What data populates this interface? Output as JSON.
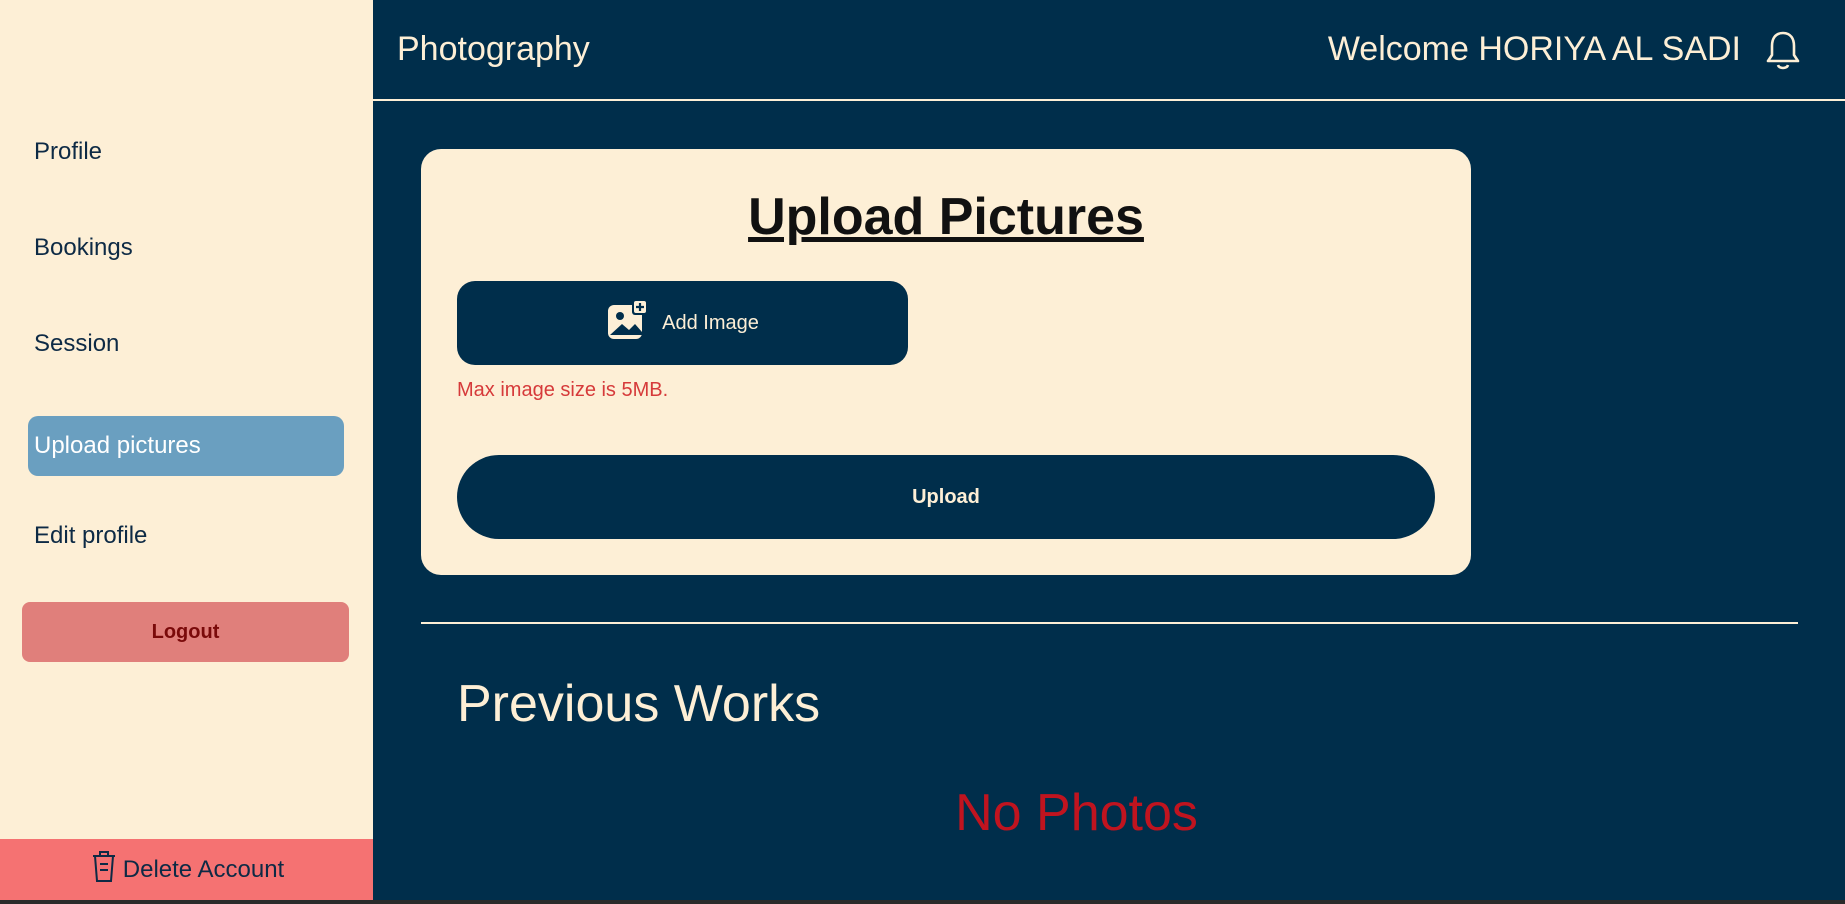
{
  "header": {
    "brand": "Photography",
    "welcome": "Welcome HORIYA AL SADI",
    "bell_icon": "bell-icon"
  },
  "sidebar": {
    "items": [
      {
        "label": "Profile",
        "active": false
      },
      {
        "label": "Bookings",
        "active": false
      },
      {
        "label": "Session",
        "active": false
      },
      {
        "label": "Upload pictures",
        "active": true
      },
      {
        "label": "Edit profile",
        "active": false
      }
    ],
    "logout_label": "Logout",
    "delete_label": "Delete Account",
    "delete_icon": "trash-icon"
  },
  "upload_card": {
    "title": "Upload Pictures",
    "add_image_label": "Add Image",
    "add_image_icon": "add-image-icon",
    "size_note": "Max image size is 5MB.",
    "upload_label": "Upload"
  },
  "previous_works": {
    "title": "Previous Works",
    "empty_text": "No Photos"
  },
  "colors": {
    "navy": "#002e4b",
    "cream": "#fdefd6",
    "active_blue": "#6a9fc0",
    "logout_bg": "#e07f7b",
    "delete_bg": "#f57272",
    "error_red": "#c0141f"
  }
}
